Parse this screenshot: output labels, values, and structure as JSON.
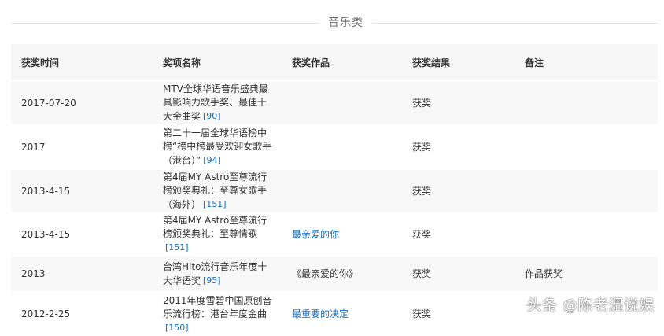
{
  "section": {
    "title": "音乐类"
  },
  "table": {
    "headers": [
      "获奖时间",
      "奖项名称",
      "获奖作品",
      "获奖结果",
      "备注"
    ],
    "rows": [
      {
        "date": "2017-07-20",
        "award": "MTV全球华语音乐盛典最具影响力歌手奖、最佳十大金曲奖",
        "ref": "[90]",
        "work": "",
        "result": "获奖",
        "note": ""
      },
      {
        "date": "2017",
        "award": "第二十一届全球华语榜中榜“榜中榜最受欢迎女歌手（港台）”",
        "ref": "[94]",
        "work": "",
        "result": "获奖",
        "note": ""
      },
      {
        "date": "2013-4-15",
        "award": "第4届MY Astro至尊流行榜颁奖典礼：至尊女歌手（海外）",
        "ref": "[151]",
        "work": "",
        "result": "获奖",
        "note": ""
      },
      {
        "date": "2013-4-15",
        "award": "第4届MY Astro至尊流行榜颁奖典礼：至尊情歌",
        "ref": "[151]",
        "work": "最亲爱的你",
        "result": "获奖",
        "note": ""
      },
      {
        "date": "2013",
        "award": "台湾Hito流行音乐年度十大华语奖",
        "ref": "[95]",
        "work": "《最亲爱的你》",
        "result": "获奖",
        "note": "作品获奖"
      },
      {
        "date": "2012-2-25",
        "award": "2011年度雪碧中国原创音乐流行榜：港台年度金曲",
        "ref": "[150]",
        "work": "最重要的决定",
        "result": "获奖",
        "note": ""
      }
    ]
  },
  "watermark": "头条 @陈老湿说娱",
  "colors": {
    "link": "#136ec2",
    "header_bg": "#f7f7f7",
    "stripe_bg": "#f8f8f8"
  }
}
